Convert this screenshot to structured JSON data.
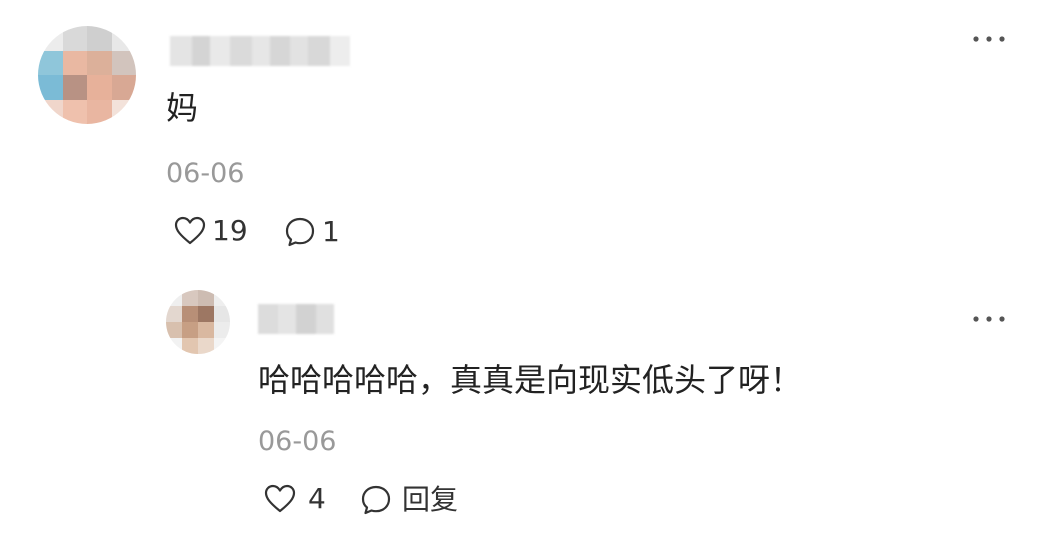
{
  "comment": {
    "content": "妈",
    "date": "06-06",
    "likes": "19",
    "replies": "1",
    "more_icon": "more-dots-icon",
    "like_icon": "heart-outline-icon",
    "reply_icon": "chat-bubble-icon"
  },
  "reply": {
    "content": "哈哈哈哈哈，真真是向现实低头了呀！",
    "date": "06-06",
    "likes": "4",
    "reply_label": "回复",
    "more_icon": "more-dots-icon",
    "like_icon": "heart-outline-icon",
    "reply_icon": "chat-bubble-icon"
  }
}
